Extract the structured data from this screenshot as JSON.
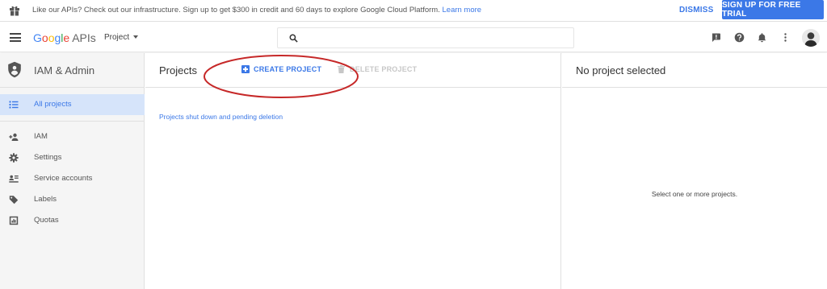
{
  "promo": {
    "message": "Like our APIs? Check out our infrastructure. Sign up to get $300 in credit and 60 days to explore Google Cloud Platform.",
    "learn_more": "Learn more",
    "dismiss": "DISMISS",
    "signup": "SIGN UP FOR FREE TRIAL"
  },
  "header": {
    "logo_g": "G",
    "logo_o1": "o",
    "logo_o2": "o",
    "logo_g2": "g",
    "logo_l": "l",
    "logo_e": "e",
    "logo_apis": "APIs",
    "project_select": "Project",
    "search_placeholder": ""
  },
  "sidebar": {
    "title": "IAM & Admin",
    "items": [
      {
        "label": "All projects",
        "icon": "list-icon",
        "active": true
      },
      {
        "label": "IAM",
        "icon": "person-add-icon"
      },
      {
        "label": "Settings",
        "icon": "gear-icon"
      },
      {
        "label": "Service accounts",
        "icon": "service-account-icon"
      },
      {
        "label": "Labels",
        "icon": "label-icon"
      },
      {
        "label": "Quotas",
        "icon": "quota-icon"
      }
    ]
  },
  "main": {
    "title": "Projects",
    "create_label": "CREATE PROJECT",
    "delete_label": "DELETE PROJECT",
    "shutdown_link": "Projects shut down and pending deletion"
  },
  "right": {
    "title": "No project selected",
    "empty_message": "Select one or more projects."
  },
  "colors": {
    "accent": "#3b78e7",
    "annotation": "#c62828",
    "active_bg": "#d6e4fa"
  }
}
